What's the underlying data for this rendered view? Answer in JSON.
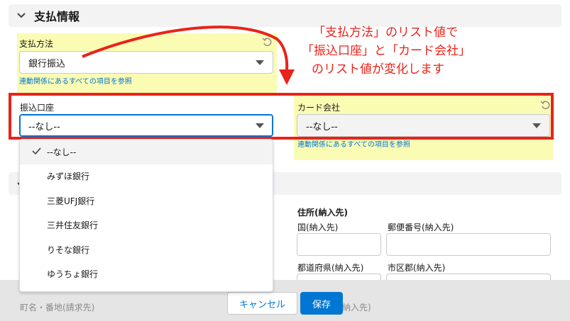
{
  "section": {
    "title": "支払情報"
  },
  "payment_method": {
    "label": "支払方法",
    "value": "銀行振込",
    "dependency_link": "連動関係にあるすべての項目を参照"
  },
  "bank_account": {
    "label": "振込口座",
    "value": "--なし--",
    "options": [
      "--なし--",
      "みずほ銀行",
      "三菱UFJ銀行",
      "三井住友銀行",
      "りそな銀行",
      "ゆうちょ銀行"
    ],
    "selected_index": 0
  },
  "card_company": {
    "label": "カード会社",
    "value": "--なし--",
    "dependency_link": "連動関係にあるすべての項目を参照"
  },
  "annotation": {
    "lines": [
      "「支払方法」のリスト値で",
      "「振込口座」と「カード会社」",
      "のリスト値が変化します"
    ],
    "color": "#e8231a"
  },
  "address": {
    "heading": "住所(納入先)",
    "country_label": "国(納入先)",
    "postal_label": "郵便番号(納入先)",
    "prefecture_label": "都道府県(納入先)",
    "city_label": "市区郡(納入先)",
    "street_billing_label": "町名・番地(請求先)",
    "partial_label": "納入先)"
  },
  "footer": {
    "cancel_label": "キャンセル",
    "save_label": "保存"
  },
  "colors": {
    "highlight": "#fbfcb4",
    "brand": "#0176d3",
    "annotation": "#e8231a"
  }
}
